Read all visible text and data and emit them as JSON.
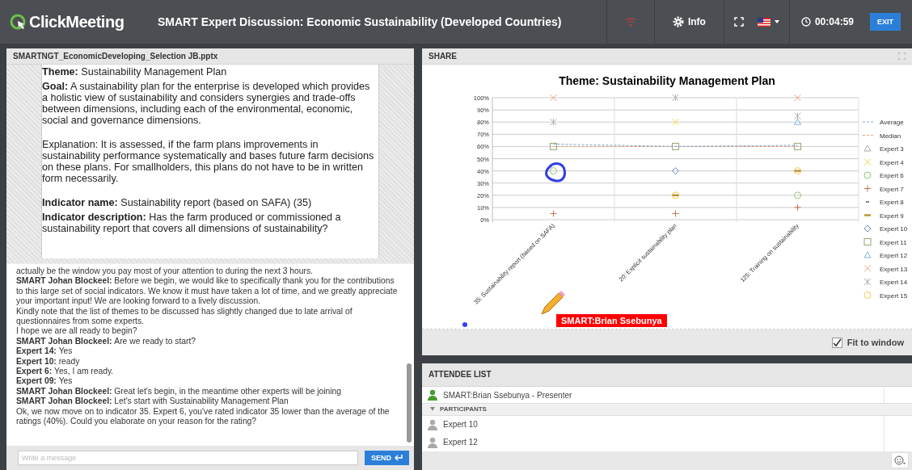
{
  "topbar": {
    "logo": "ClickMeeting",
    "title": "SMART Expert Discussion: Economic Sustainability (Developed Countries)",
    "info": "Info",
    "timer": "00:04:59",
    "exit": "EXIT"
  },
  "presentation": {
    "file": "SMARTNGT_EconomicDeveloping_Selection JB.pptx",
    "sections": [
      [
        "**Theme:** Sustainability Management Plan",
        "**Goal:** A sustainability plan for the enterprise is developed which provides a holistic view of sustainability and considers synergies and trade-offs between dimensions, including each of the environmental, economic, social and governance dimensions."
      ],
      [
        "Explanation: It is assessed, if the farm plans improvements in sustainability performance systematically and bases future farm decisions on these plans. For smallholders, this plans do not have to be in written form necessarily."
      ],
      [
        "**Indicator name:** Sustainability report (based on SAFA) (35)",
        "**Indicator description:** Has the farm produced or commissioned a sustainability report that covers all dimensions of sustainability?"
      ]
    ]
  },
  "chat": {
    "messages": [
      {
        "text": "actually be the window you pay most of your attention to during the next 3 hours."
      },
      {
        "author": "SMART Johan Blockeel:",
        "text": "Before we begin, we would like to specifically thank you for the contributions to this large set of social indicators. We know it must have taken a lot of time, and we greatly appreciate your important input! We are looking forward to a lively discussion."
      },
      {
        "text": "Kindly note that the list of themes to be discussed has slightly changed due to late arrival of questionnaires from some experts."
      },
      {
        "text": "I hope we are all ready to begin?"
      },
      {
        "author": "SMART Johan Blockeel:",
        "text": "Are we ready to start?"
      },
      {
        "author": "Expert 14:",
        "text": "Yes"
      },
      {
        "author": "Expert 10:",
        "text": "ready"
      },
      {
        "author": "Expert 6:",
        "text": "Yes, I am ready."
      },
      {
        "author": "Expert 09:",
        "text": "Yes"
      },
      {
        "author": "SMART Johan Blockeel:",
        "text": "Great let's begin, in the meantime other experts will be joining"
      },
      {
        "author": "SMART Johan Blockeel:",
        "text": "Let's start with Sustainability Management Plan"
      },
      {
        "text": "Ok, we now move on to indicator 35. Expert 6, you've rated indicator 35 lower than the average of the ratings (40%). Could you elaborate on your reason for the rating?"
      }
    ],
    "input": {
      "placeholder": "Write a message"
    },
    "send": "SEND"
  },
  "share": {
    "header": "SHARE",
    "pointer_label": "SMART:Brian Ssebunya",
    "fit_to_window": {
      "label": "Fit to window",
      "checked": true
    },
    "chart_data": {
      "type": "scatter",
      "title": "Theme: Sustainability Management Plan",
      "categories": [
        "35: Sustainability report (based on SAFA)",
        "20: Explicit sustainability plan",
        "125: Training on sustainability"
      ],
      "ylim": [
        0,
        100
      ],
      "grid": true,
      "legend": true,
      "yticks": [
        {
          "value": 0,
          "label": "0%"
        },
        {
          "value": 10,
          "label": "10%"
        },
        {
          "value": 20,
          "label": "20%"
        },
        {
          "value": 30,
          "label": "30%"
        },
        {
          "value": 40,
          "label": "40%"
        },
        {
          "value": 50,
          "label": "50%"
        },
        {
          "value": 60,
          "label": "60%"
        },
        {
          "value": 70,
          "label": "70%"
        },
        {
          "value": 80,
          "label": "80%"
        },
        {
          "value": 90,
          "label": "90%"
        },
        {
          "value": 100,
          "label": "100%"
        }
      ],
      "series": [
        {
          "name": "Average",
          "type": "line",
          "line_style": "dashed",
          "color": "#7fa7d6",
          "values": [
            62,
            60,
            61
          ]
        },
        {
          "name": "Median",
          "type": "line",
          "line_style": "dashed",
          "color": "#f0a070",
          "values": [
            60,
            60,
            60
          ]
        },
        {
          "name": "Expert 3",
          "color": "#a8a8a8",
          "values": [
            null,
            null,
            null
          ]
        },
        {
          "name": "Expert 4",
          "color": "#f5d040",
          "values": [
            null,
            80,
            null
          ]
        },
        {
          "name": "Expert 6",
          "color": "#9bc37a",
          "values": [
            40,
            null,
            20
          ]
        },
        {
          "name": "Expert 7",
          "color": "#c07050",
          "values": [
            5,
            5,
            10
          ]
        },
        {
          "name": "Expert 8",
          "color": "#606060",
          "values": [
            null,
            null,
            null
          ]
        },
        {
          "name": "Expert 9",
          "color": "#c09030",
          "values": [
            null,
            20,
            40
          ]
        },
        {
          "name": "Expert 10",
          "color": "#7080c0",
          "values": [
            null,
            40,
            null
          ]
        },
        {
          "name": "Expert 11",
          "color": "#90a870",
          "values": [
            60,
            60,
            60
          ]
        },
        {
          "name": "Expert 12",
          "color": "#80b0e0",
          "values": [
            null,
            null,
            80
          ]
        },
        {
          "name": "Expert 13",
          "color": "#f0a080",
          "values": [
            100,
            null,
            100
          ]
        },
        {
          "name": "Expert 14",
          "color": "#b0b0b0",
          "values": [
            80,
            100,
            85
          ]
        },
        {
          "name": "Expert 15",
          "color": "#f5c850",
          "values": [
            null,
            20,
            40
          ]
        }
      ]
    }
  },
  "attendees": {
    "header": "ATTENDEE LIST",
    "presenter": "SMART:Brian Ssebunya - Presenter",
    "section": {
      "label": "PARTICIPANTS",
      "expanded": true
    },
    "participants": [
      "Expert 10",
      "Expert 12"
    ]
  }
}
